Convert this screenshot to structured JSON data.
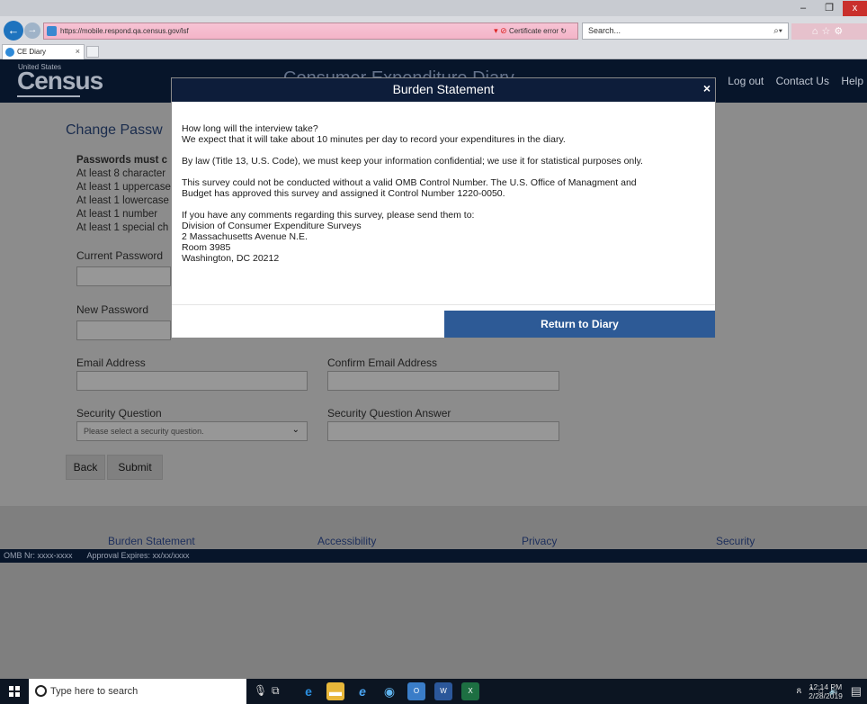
{
  "browser": {
    "url": "https://mobile.respond.qa.census.gov/lsf",
    "cert_error": "Certificate error",
    "search_placeholder": "Search...",
    "tab_title": "CE Diary",
    "window_buttons": [
      "–",
      "❐",
      "x"
    ]
  },
  "site": {
    "logo_top": "United States",
    "logo_main": "Census",
    "title": "Consumer Expenditure Diary",
    "header_links": [
      "Log out",
      "Contact Us",
      "Help"
    ]
  },
  "form": {
    "heading": "Change Passw",
    "requirements_title": "Passwords must c",
    "requirements": [
      "At least 8 character",
      "At least 1 uppercase",
      "At least 1 lowercase",
      "At least 1 number",
      "At least 1 special ch"
    ],
    "current_password_label": "Current Password",
    "new_password_label": "New Password",
    "email_label": "Email Address",
    "confirm_email_label": "Confirm Email Address",
    "security_question_label": "Security Question",
    "security_question_placeholder": "Please select a security question.",
    "security_answer_label": "Security Question Answer",
    "back_label": "Back",
    "submit_label": "Submit"
  },
  "footer": {
    "links": [
      "Burden Statement",
      "Accessibility",
      "Privacy",
      "Security"
    ],
    "omb": "OMB Nr: xxxx-xxxx",
    "approval": "Approval Expires: xx/xx/xxxx"
  },
  "modal": {
    "title": "Burden Statement",
    "close": "×",
    "paragraphs": [
      [
        "How long will the interview take?",
        "We expect that it will take about 10 minutes per day to record your expenditures in the diary."
      ],
      [
        "By law (Title 13, U.S. Code), we must keep your information confidential; we use it for statistical purposes only."
      ],
      [
        "This survey could not be conducted without a valid OMB Control Number.  The U.S. Office of Managment and",
        "Budget has approved this survey and assigned it Control Number 1220-0050."
      ],
      [
        "If you have any comments regarding this survey, please send them to:",
        "Division of Consumer Expenditure Surveys",
        "2 Massachusetts Avenue N.E.",
        "Room 3985",
        "Washington, DC 20212"
      ]
    ],
    "return_label": "Return to Diary"
  },
  "taskbar": {
    "search_placeholder": "Type here to search",
    "time": "12:14 PM",
    "date": "2/28/2019"
  },
  "colors": {
    "header_navy": "#07152a",
    "modal_button_blue": "#2d5a96",
    "address_bar_pink": "#f3b4c8",
    "close_red": "#c9302c"
  }
}
